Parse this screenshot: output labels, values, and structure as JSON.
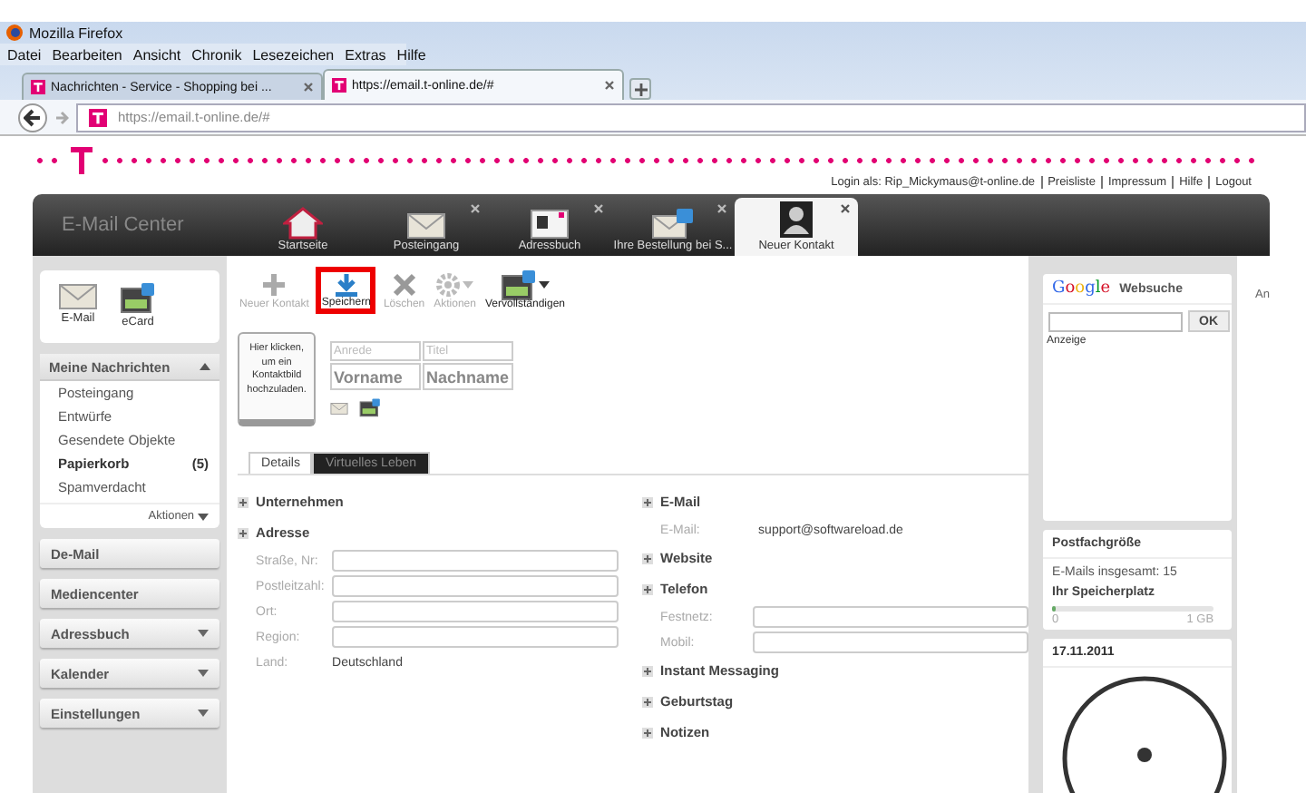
{
  "browser": {
    "title": "Mozilla Firefox",
    "menu": [
      "Datei",
      "Bearbeiten",
      "Ansicht",
      "Chronik",
      "Lesezeichen",
      "Extras",
      "Hilfe"
    ],
    "tabs": [
      {
        "label": "Nachrichten - Service - Shopping bei ...",
        "selected": false
      },
      {
        "label": "https://email.t-online.de/#",
        "selected": true
      }
    ],
    "url": "https://email.t-online.de/#"
  },
  "top_links": {
    "login": "Login als: Rip_Mickymaus@t-online.de",
    "links": [
      "Preisliste",
      "Impressum",
      "Hilfe",
      "Logout"
    ]
  },
  "header": {
    "title": "E-Mail Center",
    "tabs": [
      {
        "label": "Startseite",
        "closable": false,
        "selected": false
      },
      {
        "label": "Posteingang",
        "closable": true,
        "selected": false
      },
      {
        "label": "Adressbuch",
        "closable": true,
        "selected": false
      },
      {
        "label": "Ihre Bestellung bei S...",
        "closable": true,
        "selected": false
      },
      {
        "label": "Neuer Kontakt",
        "closable": true,
        "selected": true
      }
    ]
  },
  "sidebar": {
    "quick": [
      {
        "label": "E-Mail"
      },
      {
        "label": "eCard"
      }
    ],
    "folders": {
      "title": "Meine Nachrichten",
      "items": [
        {
          "label": "Posteingang",
          "bold": false
        },
        {
          "label": "Entwürfe",
          "bold": false
        },
        {
          "label": "Gesendete Objekte",
          "bold": false
        },
        {
          "label": "Papierkorb",
          "bold": true,
          "count": "(5)"
        },
        {
          "label": "Spamverdacht",
          "bold": false
        }
      ],
      "actions": "Aktionen"
    },
    "sections": [
      {
        "label": "De-Mail",
        "dropdown": false
      },
      {
        "label": "Mediencenter",
        "dropdown": false
      },
      {
        "label": "Adressbuch",
        "dropdown": true
      },
      {
        "label": "Kalender",
        "dropdown": true
      },
      {
        "label": "Einstellungen",
        "dropdown": true
      }
    ]
  },
  "toolbar": [
    {
      "label": "Neuer Kontakt",
      "disabled": true,
      "highlighted": false,
      "menu": false
    },
    {
      "label": "Speichern",
      "disabled": false,
      "highlighted": true,
      "menu": false
    },
    {
      "label": "Löschen",
      "disabled": true,
      "highlighted": false,
      "menu": false
    },
    {
      "label": "Aktionen",
      "disabled": true,
      "highlighted": false,
      "menu": true
    },
    {
      "label": "Vervollständigen",
      "disabled": false,
      "highlighted": false,
      "menu": true
    }
  ],
  "contact": {
    "photo_hint": "Hier klicken, um ein Kontaktbild hochzuladen.",
    "small_fields": [
      {
        "placeholder": "Anrede"
      },
      {
        "placeholder": "Titel"
      }
    ],
    "name_fields": [
      {
        "placeholder": "Vorname"
      },
      {
        "placeholder": "Nachname"
      }
    ]
  },
  "detail_tabs": [
    {
      "label": "Details",
      "selected": true
    },
    {
      "label": "Virtuelles Leben",
      "selected": false
    }
  ],
  "columns": [
    [
      {
        "title": "Unternehmen"
      },
      {
        "title": "Adresse",
        "fields": [
          {
            "label": "Straße, Nr:",
            "kind": "input"
          },
          {
            "label": "Postleitzahl:",
            "kind": "input"
          },
          {
            "label": "Ort:",
            "kind": "input"
          },
          {
            "label": "Region:",
            "kind": "input"
          },
          {
            "label": "Land:",
            "kind": "text",
            "value": "Deutschland"
          }
        ]
      }
    ],
    [
      {
        "title": "E-Mail",
        "fields": [
          {
            "label": "E-Mail:",
            "kind": "text",
            "value": "support@softwareload.de"
          }
        ]
      },
      {
        "title": "Website"
      },
      {
        "title": "Telefon",
        "fields": [
          {
            "label": "Festnetz:",
            "kind": "input"
          },
          {
            "label": "Mobil:",
            "kind": "input"
          }
        ]
      },
      {
        "title": "Instant Messaging"
      },
      {
        "title": "Geburtstag"
      },
      {
        "title": "Notizen"
      }
    ]
  ],
  "right": {
    "search": {
      "logo": "Google",
      "title": "Websuche",
      "button": "OK",
      "ad": "Anzeige"
    },
    "mailbox": {
      "title": "Postfachgröße",
      "total": "E-Mails insgesamt: 15",
      "storage": "Ihr Speicherplatz",
      "level": 0.0,
      "min": "0",
      "max": "1 GB"
    },
    "date": "17.11.2011"
  },
  "edge_text": "An"
}
